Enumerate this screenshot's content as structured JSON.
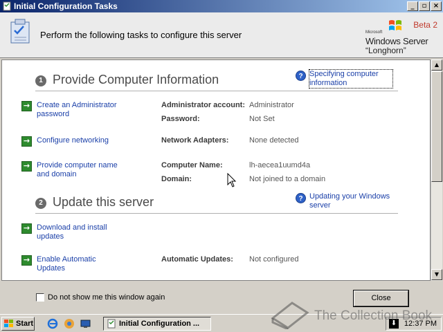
{
  "window": {
    "title": "Initial Configuration Tasks"
  },
  "header": {
    "text": "Perform the following tasks to configure this server",
    "brand": {
      "beta": "Beta 2",
      "microsoft": "Microsoft",
      "product": "Windows Server",
      "codename": "“Longhorn”"
    }
  },
  "sections": [
    {
      "number": "1",
      "title": "Provide Computer Information",
      "help": "Specifying computer information",
      "tasks": [
        {
          "label": "Create an Administrator password",
          "details": [
            {
              "key": "Administrator account:",
              "value": "Administrator"
            },
            {
              "key": "Password:",
              "value": "Not Set"
            }
          ]
        },
        {
          "label": "Configure networking",
          "details": [
            {
              "key": "Network Adapters:",
              "value": "None detected"
            }
          ]
        },
        {
          "label": "Provide computer name and domain",
          "details": [
            {
              "key": "Computer Name:",
              "value": "lh-aecea1uumd4a"
            },
            {
              "key": "Domain:",
              "value": "Not joined to a domain"
            }
          ]
        }
      ]
    },
    {
      "number": "2",
      "title": "Update this server",
      "help": "Updating your Windows server",
      "tasks": [
        {
          "label": "Download and install updates",
          "details": []
        },
        {
          "label": "Enable Automatic Updates",
          "details": [
            {
              "key": "Automatic Updates:",
              "value": "Not configured"
            }
          ]
        }
      ]
    }
  ],
  "footer": {
    "checkbox_label": "Do not show me this window again",
    "close_label": "Close"
  },
  "taskbar": {
    "start_label": "Start",
    "task_label": "Initial Configuration ...",
    "clock": "12:37 PM"
  },
  "watermark": "The Collection Book",
  "colors": {
    "title_start": "#0a246a",
    "title_end": "#a6caf0",
    "link": "#1a3fa8",
    "go_arrow": "#2e8b2e",
    "beta": "#c0392b"
  }
}
